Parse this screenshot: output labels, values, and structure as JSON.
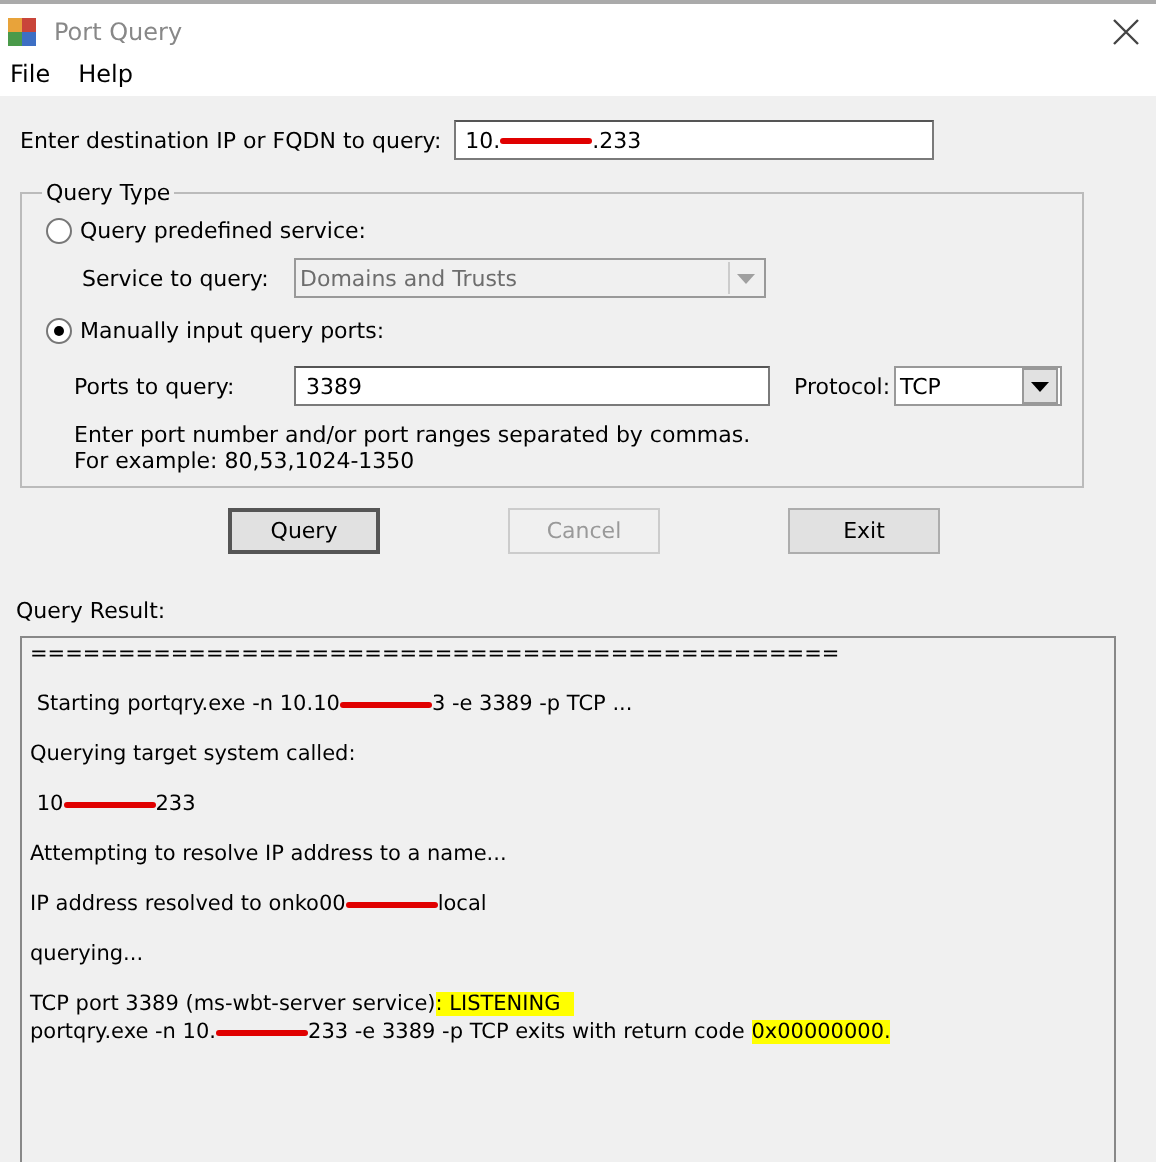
{
  "window": {
    "title": "Port Query"
  },
  "menu": [
    "File",
    "Help"
  ],
  "destination": {
    "label": "Enter destination IP or FQDN to query:",
    "value": [
      {
        "text": "10."
      },
      {
        "redacted": true
      },
      {
        "text": ".233"
      }
    ]
  },
  "query_type": {
    "title": "Query Type",
    "options": [
      {
        "label": "Query predefined service:",
        "selected": false
      },
      {
        "label": "Manually input query ports:",
        "selected": true
      }
    ],
    "service": {
      "label": "Service to query:",
      "value": "Domains and Trusts",
      "disabled": true
    },
    "ports": {
      "label": "Ports to query:",
      "value": "3389"
    },
    "protocol": {
      "label": "Protocol:",
      "value": "TCP"
    },
    "hint": [
      "Enter port number and/or port ranges separated by commas.",
      "For example: 80,53,1024-1350"
    ]
  },
  "buttons": [
    {
      "label": "Query",
      "disabled": false,
      "default": true
    },
    {
      "label": "Cancel",
      "disabled": true,
      "default": false
    },
    {
      "label": "Exit",
      "disabled": false,
      "default": false
    }
  ],
  "result": {
    "label": "Query Result:",
    "lines": [
      {
        "segments": [
          {
            "text": "=============================================="
          }
        ]
      },
      {
        "segments": [
          {
            "text": " Starting portqry.exe -n 10.10"
          },
          {
            "redacted": true
          },
          {
            "text": "3 -e 3389 -p TCP ..."
          }
        ]
      },
      {
        "segments": [
          {
            "text": "Querying target system called:"
          }
        ]
      },
      {
        "segments": [
          {
            "text": " 10"
          },
          {
            "redacted": true
          },
          {
            "text": "233"
          }
        ]
      },
      {
        "segments": [
          {
            "text": "Attempting to resolve IP address to a name..."
          }
        ]
      },
      {
        "segments": [
          {
            "text": "IP address resolved to onko00"
          },
          {
            "redacted": true
          },
          {
            "text": "local"
          }
        ]
      },
      {
        "segments": [
          {
            "text": "querying..."
          }
        ]
      },
      {
        "segments": [
          {
            "text": "TCP port 3389 (ms-wbt-server service)"
          },
          {
            "text": ": LISTENING  ",
            "highlighted": true
          }
        ]
      },
      {
        "segments": [
          {
            "text": "portqry.exe -n 10."
          },
          {
            "redacted": true
          },
          {
            "text": "233 -e 3389 -p TCP exits with return code "
          },
          {
            "text": "0x00000000.",
            "highlighted": true
          }
        ]
      }
    ]
  }
}
